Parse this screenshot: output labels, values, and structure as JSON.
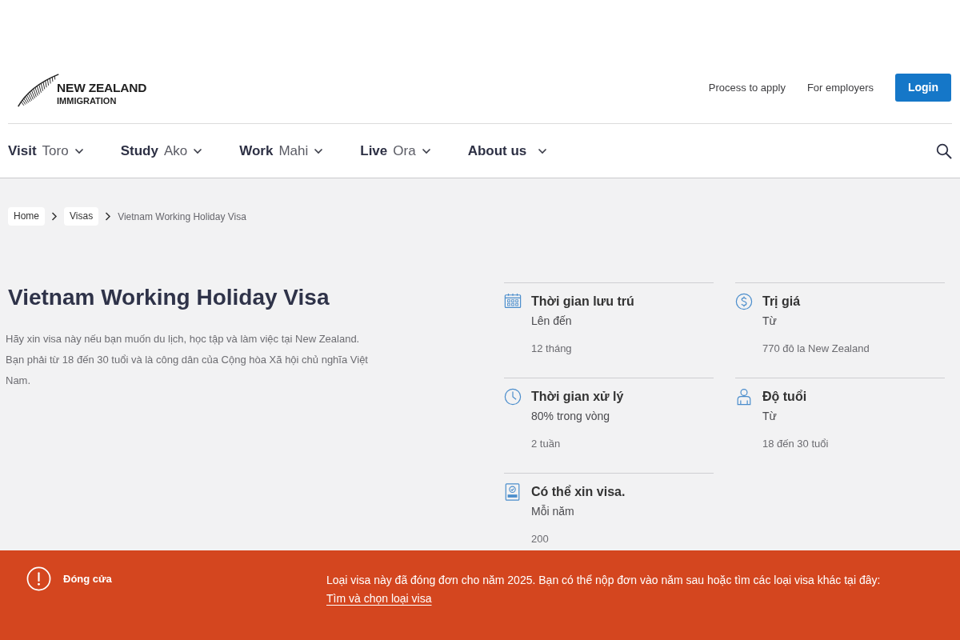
{
  "header": {
    "logo": {
      "line_1": "NEW ZEALAND",
      "line_2": "IMMIGRATION"
    },
    "top_links": [
      "Process to apply",
      "For employers"
    ],
    "login_button": "Login"
  },
  "nav": [
    {
      "label": "Visit",
      "maori": "Toro"
    },
    {
      "label": "Study",
      "maori": "Ako"
    },
    {
      "label": "Work",
      "maori": "Mahi"
    },
    {
      "label": "Live",
      "maori": "Ora"
    },
    {
      "label": "About us"
    }
  ],
  "breadcrumb": [
    {
      "label": "Home",
      "kind": "link"
    },
    {
      "label": "Visas",
      "kind": "link"
    },
    {
      "label": "Vietnam Working Holiday Visa",
      "kind": "current"
    }
  ],
  "title": "Vietnam Working Holiday Visa",
  "description": "Hãy xin visa này nếu bạn muốn du lịch, học tập và làm việc tại New Zealand. Bạn phải từ 18 đến 30 tuổi và là công dân của Cộng hòa Xã hội chủ nghĩa Việt Nam.",
  "facts": [
    {
      "kind": "duration",
      "title": "Thời gian lưu trú",
      "qualifier": "Lên đến",
      "value": "12 tháng"
    },
    {
      "kind": "cost",
      "title": "Trị giá",
      "qualifier": "Từ",
      "value": "770 đô la New Zealand"
    },
    {
      "kind": "processing",
      "title": "Thời gian xử lý",
      "qualifier": "80% trong vòng",
      "value": "2 tuần"
    },
    {
      "kind": "age",
      "title": "Độ tuổi",
      "qualifier": "Từ",
      "value": "18 đến 30 tuổi"
    },
    {
      "kind": "places",
      "title": "Có thể xin visa.",
      "qualifier": "Mỗi năm",
      "value": "200"
    }
  ],
  "notice": {
    "status": "Đóng cửa",
    "message": "Loại visa này đã đóng đơn cho năm 2025. Bạn có thể nộp đơn vào năm sau hoặc tìm các loại visa khác tại đây:",
    "link": "Tìm và chọn loại visa"
  }
}
